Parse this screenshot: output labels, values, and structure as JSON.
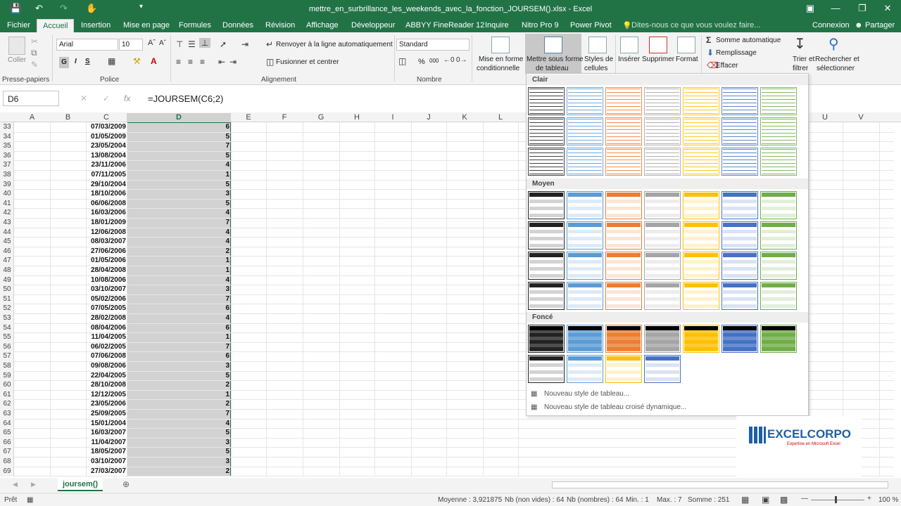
{
  "window": {
    "title": "mettre_en_surbrillance_les_weekends_avec_la_fonction_JOURSEM().xlsx - Excel",
    "accent_color": "#217346"
  },
  "tabs": [
    "Fichier",
    "Accueil",
    "Insertion",
    "Mise en page",
    "Formules",
    "Données",
    "Révision",
    "Affichage",
    "Développeur",
    "ABBYY FineReader 12",
    "Inquire",
    "Nitro Pro 9",
    "Power Pivot"
  ],
  "tell_me": "Dites-nous ce que vous voulez faire...",
  "account": {
    "signin": "Connexion",
    "share": "Partager"
  },
  "ribbon": {
    "clipboard": {
      "paste": "Coller",
      "group": "Presse-papiers"
    },
    "font": {
      "name": "Arial",
      "size": "10",
      "bold": "G",
      "italic": "I",
      "underline": "S",
      "group": "Police"
    },
    "alignment": {
      "wrap": "Renvoyer à la ligne automatiquement",
      "merge": "Fusionner et centrer",
      "group": "Alignement"
    },
    "number": {
      "format": "Standard",
      "percent": "%",
      "thousands": "000",
      "group": "Nombre"
    },
    "styles": {
      "cond1": "Mise en forme",
      "cond2": "conditionnelle",
      "table1": "Mettre sous forme",
      "table2": "de tableau",
      "cell1": "Styles de",
      "cell2": "cellules"
    },
    "cells": {
      "insert": "Insérer",
      "delete": "Supprimer",
      "format": "Format"
    },
    "editing": {
      "autosum": "Somme automatique",
      "fill": "Remplissage",
      "clear": "Effacer",
      "sort1": "Trier et",
      "sort2": "filtrer",
      "find1": "Rechercher et",
      "find2": "sélectionner"
    }
  },
  "formula_bar": {
    "name_box": "D6",
    "fx": "fx",
    "formula": "=JOURSEM(C6;2)"
  },
  "columns": [
    "A",
    "B",
    "C",
    "D",
    "E",
    "F",
    "G",
    "H",
    "I",
    "J",
    "K",
    "L",
    "U",
    "V"
  ],
  "rows": [
    {
      "n": "33",
      "c": "07/03/2009",
      "d": "6"
    },
    {
      "n": "34",
      "c": "01/05/2009",
      "d": "5"
    },
    {
      "n": "35",
      "c": "23/05/2004",
      "d": "7"
    },
    {
      "n": "36",
      "c": "13/08/2004",
      "d": "5"
    },
    {
      "n": "37",
      "c": "23/11/2006",
      "d": "4"
    },
    {
      "n": "38",
      "c": "07/11/2005",
      "d": "1"
    },
    {
      "n": "39",
      "c": "29/10/2004",
      "d": "5"
    },
    {
      "n": "40",
      "c": "18/10/2006",
      "d": "3"
    },
    {
      "n": "41",
      "c": "06/06/2008",
      "d": "5"
    },
    {
      "n": "42",
      "c": "16/03/2006",
      "d": "4"
    },
    {
      "n": "43",
      "c": "18/01/2009",
      "d": "7"
    },
    {
      "n": "44",
      "c": "12/06/2008",
      "d": "4"
    },
    {
      "n": "45",
      "c": "08/03/2007",
      "d": "4"
    },
    {
      "n": "46",
      "c": "27/06/2006",
      "d": "2"
    },
    {
      "n": "47",
      "c": "01/05/2006",
      "d": "1"
    },
    {
      "n": "48",
      "c": "28/04/2008",
      "d": "1"
    },
    {
      "n": "49",
      "c": "10/08/2006",
      "d": "4"
    },
    {
      "n": "50",
      "c": "03/10/2007",
      "d": "3"
    },
    {
      "n": "51",
      "c": "05/02/2006",
      "d": "7"
    },
    {
      "n": "52",
      "c": "07/05/2005",
      "d": "6"
    },
    {
      "n": "53",
      "c": "28/02/2008",
      "d": "4"
    },
    {
      "n": "54",
      "c": "08/04/2006",
      "d": "6"
    },
    {
      "n": "55",
      "c": "11/04/2005",
      "d": "1"
    },
    {
      "n": "56",
      "c": "06/02/2005",
      "d": "7"
    },
    {
      "n": "57",
      "c": "07/06/2008",
      "d": "6"
    },
    {
      "n": "58",
      "c": "09/08/2006",
      "d": "3"
    },
    {
      "n": "59",
      "c": "22/04/2005",
      "d": "5"
    },
    {
      "n": "60",
      "c": "28/10/2008",
      "d": "2"
    },
    {
      "n": "61",
      "c": "12/12/2005",
      "d": "1"
    },
    {
      "n": "62",
      "c": "23/05/2006",
      "d": "2"
    },
    {
      "n": "63",
      "c": "25/09/2005",
      "d": "7"
    },
    {
      "n": "64",
      "c": "15/01/2004",
      "d": "4"
    },
    {
      "n": "65",
      "c": "16/03/2007",
      "d": "5"
    },
    {
      "n": "66",
      "c": "11/04/2007",
      "d": "3"
    },
    {
      "n": "67",
      "c": "18/05/2007",
      "d": "5"
    },
    {
      "n": "68",
      "c": "03/10/2007",
      "d": "3"
    },
    {
      "n": "69",
      "c": "27/03/2007",
      "d": "2"
    }
  ],
  "gallery": {
    "sections": {
      "light": "Clair",
      "medium": "Moyen",
      "dark": "Foncé"
    },
    "palette": [
      "#222222",
      "#5b9bd5",
      "#ed7d31",
      "#a5a5a5",
      "#ffc000",
      "#4472c4",
      "#70ad47"
    ],
    "new_table_style": "Nouveau style de tableau...",
    "new_pivot_style": "Nouveau style de tableau croisé dynamique..."
  },
  "sheet": {
    "tab": "joursem()"
  },
  "status": {
    "ready": "Prêt",
    "average": "Moyenne : 3,921875",
    "count": "Nb (non vides) : 64",
    "numcount": "Nb (nombres) : 64",
    "min": "Min. : 1",
    "max": "Max. : 7",
    "sum": "Somme : 251",
    "zoom": "100 %"
  },
  "logo": {
    "name": "EXCELCORPO",
    "tagline": "Expertise en Microsoft Excel"
  }
}
